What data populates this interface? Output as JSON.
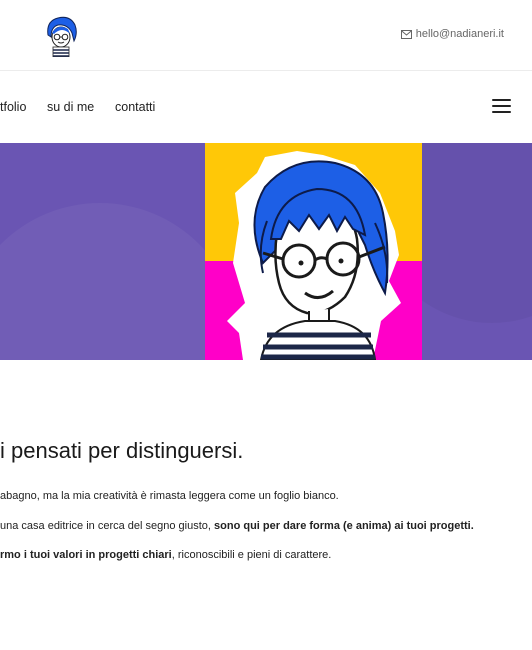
{
  "header": {
    "email": "hello@nadianeri.it",
    "icons": {
      "logo": "avatar-logo-icon",
      "email": "envelope-icon"
    }
  },
  "nav": {
    "items": [
      {
        "label": "tfolio"
      },
      {
        "label": "su di me"
      },
      {
        "label": "contatti"
      }
    ],
    "menu_icon": "hamburger-menu-icon"
  },
  "hero": {
    "background_color": "#6a55b3",
    "portrait_colors": {
      "top": "#ffc807",
      "bottom": "#ff00c8",
      "hair": "#1d5fe6"
    }
  },
  "content": {
    "headline": "i pensati per distinguersi.",
    "p1": "abagno, ma la mia creatività è rimasta leggera come un foglio bianco.",
    "p2_normal": " una casa editrice in cerca del segno giusto, ",
    "p2_bold": "sono qui per dare forma (e anima) ai tuoi progetti.",
    "p3_bold": "rmo i tuoi valori in progetti chiari",
    "p3_normal": ", riconoscibili e pieni di carattere."
  }
}
